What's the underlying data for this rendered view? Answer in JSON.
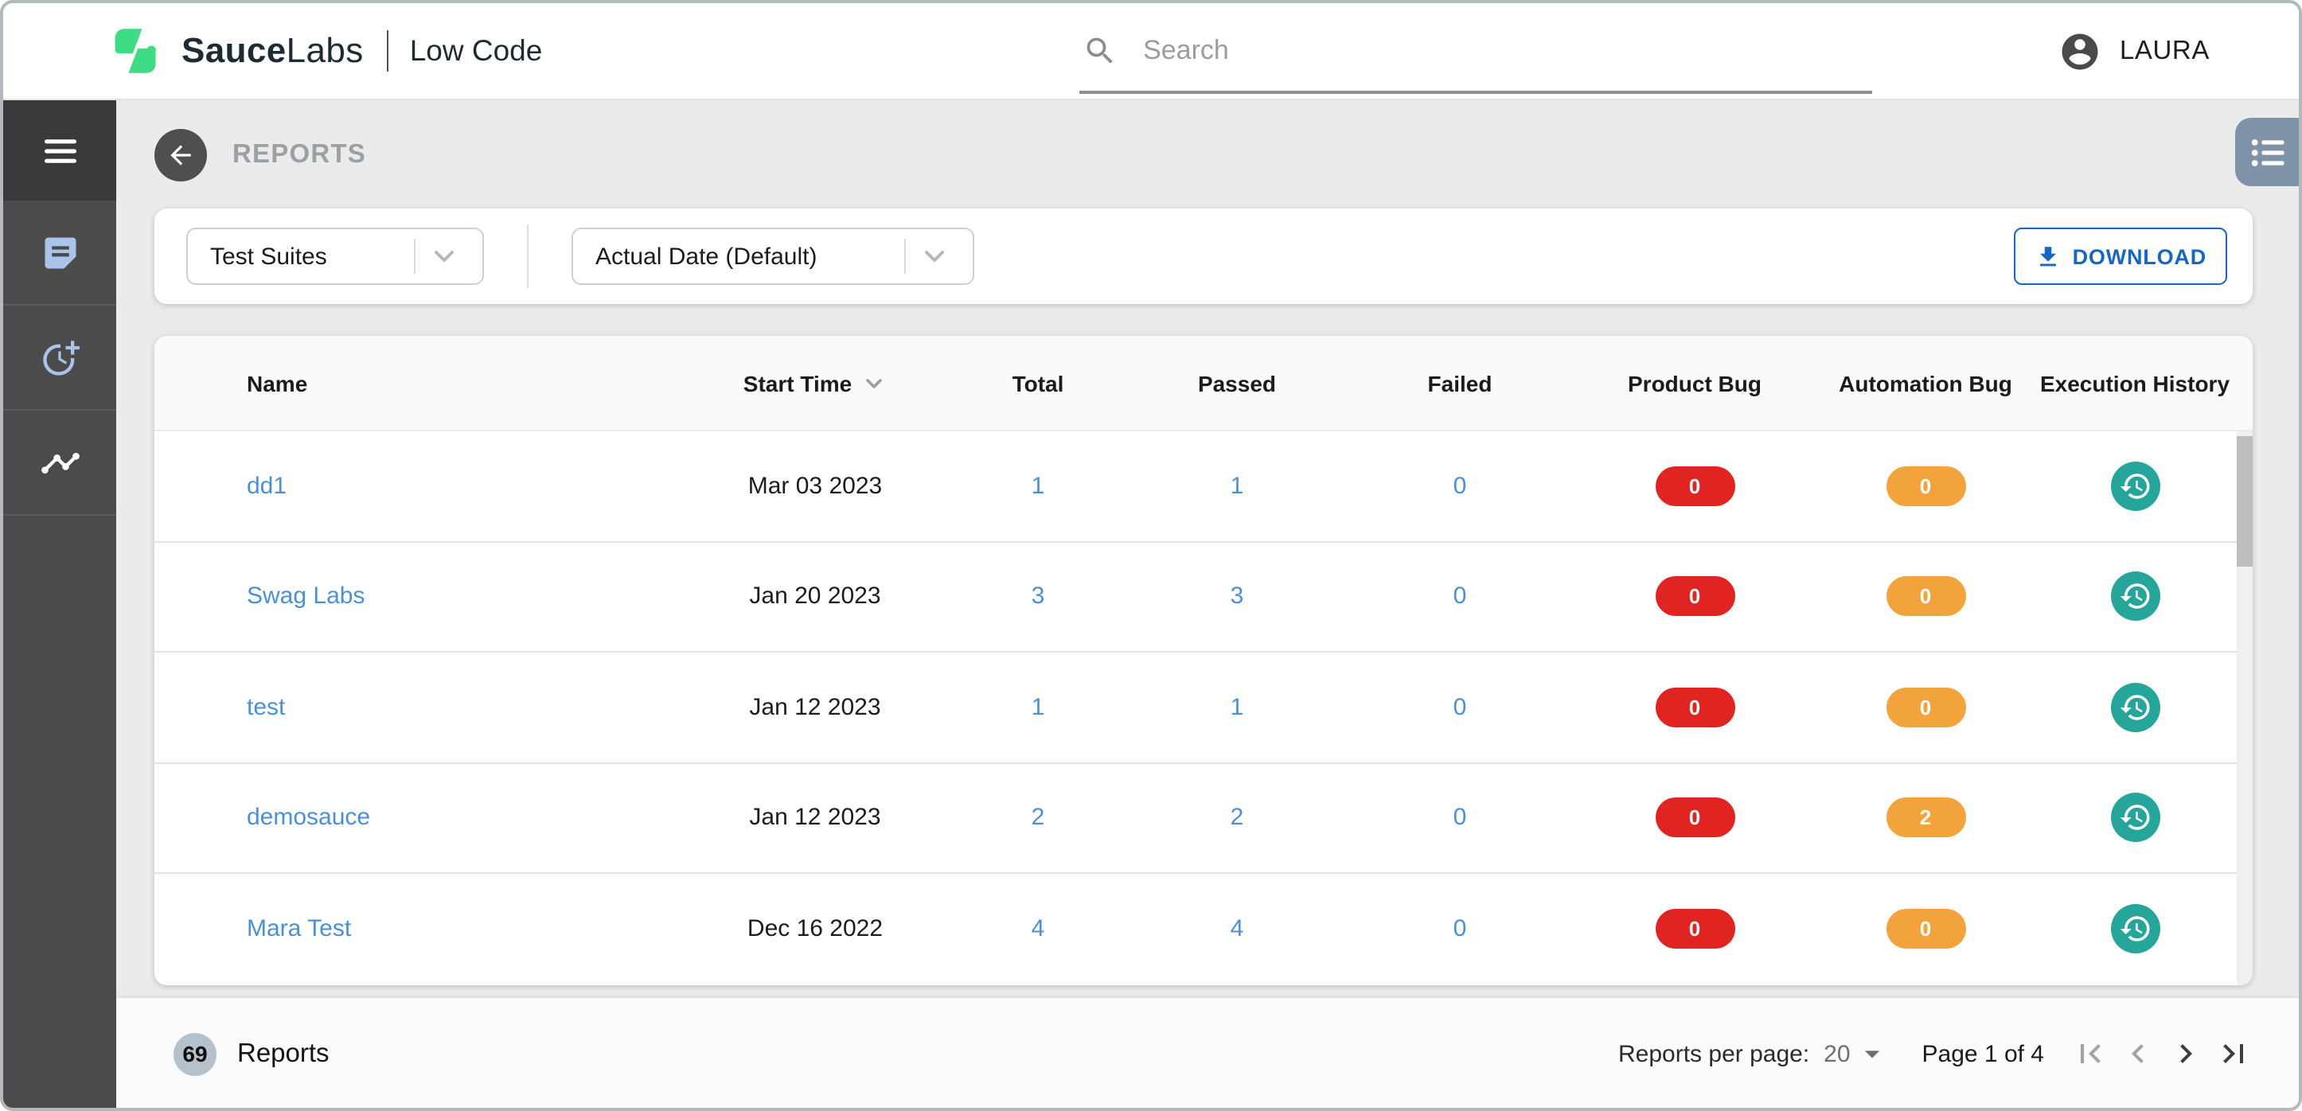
{
  "topbar": {
    "brand_bold": "Sauce",
    "brand_light": "Labs",
    "product": "Low Code",
    "search_placeholder": "Search",
    "user": "LAURA"
  },
  "page": {
    "title": "REPORTS"
  },
  "filters": {
    "suite_filter": "Test Suites",
    "date_filter": "Actual Date (Default)",
    "download_label": "DOWNLOAD"
  },
  "table": {
    "columns": [
      "Name",
      "Start Time",
      "Total",
      "Passed",
      "Failed",
      "Product Bug",
      "Automation Bug",
      "Execution History"
    ],
    "rows": [
      {
        "name": "dd1",
        "start_time": "Mar 03 2023",
        "total": "1",
        "passed": "1",
        "failed": "0",
        "product_bug": "0",
        "automation_bug": "0"
      },
      {
        "name": "Swag Labs",
        "start_time": "Jan 20 2023",
        "total": "3",
        "passed": "3",
        "failed": "0",
        "product_bug": "0",
        "automation_bug": "0"
      },
      {
        "name": "test",
        "start_time": "Jan 12 2023",
        "total": "1",
        "passed": "1",
        "failed": "0",
        "product_bug": "0",
        "automation_bug": "0"
      },
      {
        "name": "demosauce",
        "start_time": "Jan 12 2023",
        "total": "2",
        "passed": "2",
        "failed": "0",
        "product_bug": "0",
        "automation_bug": "2"
      },
      {
        "name": "Mara Test",
        "start_time": "Dec 16 2022",
        "total": "4",
        "passed": "4",
        "failed": "0",
        "product_bug": "0",
        "automation_bug": "0"
      }
    ]
  },
  "footer": {
    "count": "69",
    "count_label": "Reports",
    "per_page_label": "Reports per page:",
    "per_page_value": "20",
    "page_info": "Page 1 of 4"
  },
  "icons": {
    "brand": "saucelabs-bolt",
    "search": "magnifier",
    "user": "account-circle",
    "menu": "hamburger",
    "sidebar_1": "document",
    "sidebar_2": "clock-plus",
    "sidebar_3": "trend-line",
    "back": "arrow-left-circle",
    "view": "bulleted-list",
    "download": "download-arrow",
    "sort": "chevron-down",
    "history": "clock-history",
    "pagination": [
      "first-page",
      "chevron-left",
      "chevron-right",
      "last-page"
    ]
  },
  "colors": {
    "accent_blue": "#1666c5",
    "link_blue": "#4a90d9",
    "badge_red": "#e02421",
    "badge_orange": "#f2a33c",
    "history_teal": "#26a69a",
    "brand_green": "#3ddc85"
  }
}
